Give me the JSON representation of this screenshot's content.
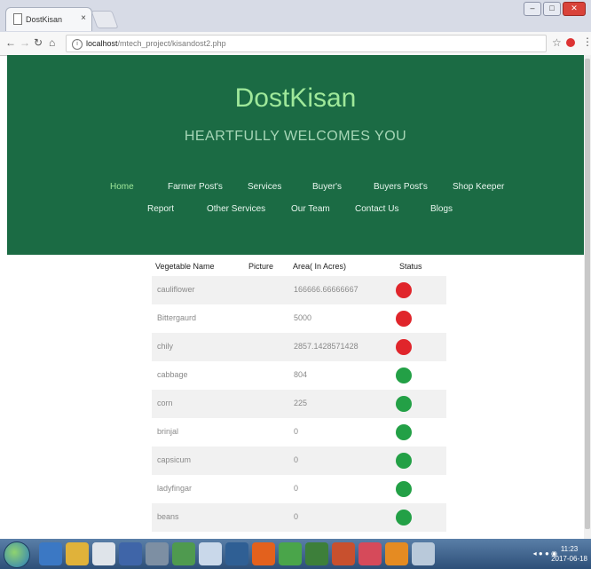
{
  "browser": {
    "tab_title": "DostKisan",
    "tab_close": "×",
    "url_host": "localhost",
    "url_path": "/mtech_project/kisandost2.php",
    "window_buttons": [
      "–",
      "□",
      "✕"
    ]
  },
  "site": {
    "brand": "DostKisan",
    "tagline": "HEARTFULLY WELCOMES YOU",
    "nav_row1": [
      "Home",
      "Farmer Post's",
      "Services",
      "Buyer's",
      "Buyers Post's",
      "Shop Keeper"
    ],
    "nav_row2": [
      "Report",
      "Other Services",
      "Our Team",
      "Contact Us",
      "Blogs"
    ]
  },
  "table": {
    "headers": [
      "Vegetable Name",
      "Picture",
      "Area( In Acres)",
      "Status"
    ],
    "rows": [
      {
        "name": "cauliflower",
        "area": "166666.66666667",
        "status": "red"
      },
      {
        "name": "Bittergaurd",
        "area": "5000",
        "status": "red"
      },
      {
        "name": "chily",
        "area": "2857.1428571428",
        "status": "red"
      },
      {
        "name": "cabbage",
        "area": "804",
        "status": "green"
      },
      {
        "name": "corn",
        "area": "225",
        "status": "green"
      },
      {
        "name": "brinjal",
        "area": "0",
        "status": "green"
      },
      {
        "name": "capsicum",
        "area": "0",
        "status": "green"
      },
      {
        "name": "ladyfingar",
        "area": "0",
        "status": "green"
      },
      {
        "name": "beans",
        "area": "0",
        "status": "green"
      }
    ]
  },
  "colors": {
    "header_bg": "#1b6b44",
    "brand_text": "#9fe89a",
    "status_red": "#e0252b",
    "status_green": "#23a046"
  },
  "taskbar": {
    "clock_time": "11:23",
    "clock_date": "2017-06-18"
  }
}
